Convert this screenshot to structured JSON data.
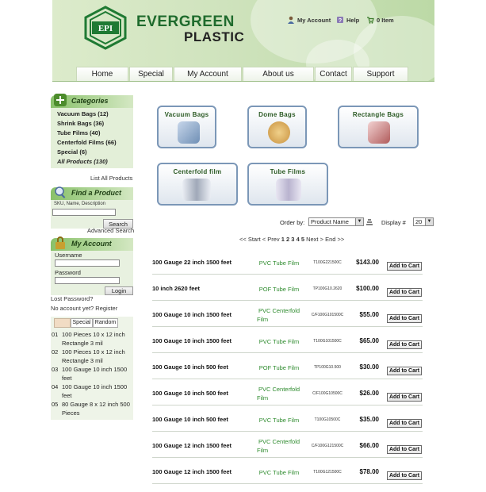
{
  "header": {
    "brand_line1": "EVERGREEN",
    "brand_line2": "PLASTIC",
    "logo_text": "EPI",
    "links": {
      "account": "My Account",
      "help": "Help",
      "cart": "0 Item"
    }
  },
  "nav": [
    {
      "label": "Home"
    },
    {
      "label": "Special"
    },
    {
      "label": "My Account"
    },
    {
      "label": "About us"
    },
    {
      "label": "Contact"
    },
    {
      "label": "Support"
    }
  ],
  "sidebar": {
    "categories_title": "Categories",
    "categories": [
      "Vacuum Bags (12)",
      "Shrink Bags (36)",
      "Tube Films (40)",
      "Centerfold Films (66)",
      "Special (6)",
      "All Products (130)"
    ],
    "list_all": "List All Products",
    "find_title": "Find a Product",
    "find_hint": "SKU, Name, Description",
    "search_button": "Search",
    "advanced_search": "Advanced Search",
    "account_title": "My Account",
    "username_label": "Username",
    "password_label": "Password",
    "login_button": "Login",
    "lost_password": "Lost Password?",
    "no_account": "No account yet? Register",
    "tabs": [
      "",
      "Special",
      "Random"
    ],
    "random_items": [
      {
        "num": "01",
        "line1": "100 Pieces 10 x 12 inch",
        "line2": "Rectangle 3 mil"
      },
      {
        "num": "02",
        "line1": "100 Pieces 10 x 12 inch",
        "line2": "Rectangle 3 mil"
      },
      {
        "num": "03",
        "line1": "100 Gauge 10 inch 1500",
        "line2": "feet"
      },
      {
        "num": "04",
        "line1": "100 Gauge 10 inch 1500",
        "line2": "feet"
      },
      {
        "num": "05",
        "line1": "80 Gauge 8 x 12 inch 500",
        "line2": "Pieces"
      }
    ]
  },
  "category_buttons": [
    {
      "label": "Vacuum Bags",
      "color": "#6f8fb5"
    },
    {
      "label": "Dome Bags",
      "color": "#c9923f"
    },
    {
      "label": "Rectangle Bags",
      "color": "#b05b5b"
    },
    {
      "label": "Centerfold film",
      "color": "#a0a8b8"
    },
    {
      "label": "Tube Films",
      "color": "#b9b3cf"
    }
  ],
  "listing": {
    "order_by_label": "Order by:",
    "order_by_value": "Product Name",
    "display_label": "Display #",
    "display_value": "20",
    "pagination": {
      "start": "<< Start",
      "prev": "< Prev",
      "pages": [
        "1",
        "2",
        "3",
        "4",
        "5"
      ],
      "next": "Next >",
      "end": "End >>"
    },
    "add_to_cart": "Add to Cart",
    "products": [
      {
        "name": "100 Gauge 22 inch 1500 feet",
        "cat1": "PVC Tube Film",
        "cat2": "",
        "sku": "T100G221500C",
        "price": "$143.00"
      },
      {
        "name": "10 inch 2620 feet",
        "cat1": "POF Tube Film",
        "cat2": "",
        "sku": "TP100G10.2620",
        "price": "$100.00"
      },
      {
        "name": "100 Gauge 10 inch 1500 feet",
        "cat1": "PVC Centerfold",
        "cat2": "Film",
        "sku": "C/F100G101500C",
        "price": "$55.00"
      },
      {
        "name": "100 Gauge 10 inch 1500 feet",
        "cat1": "PVC Tube Film",
        "cat2": "",
        "sku": "T100G101500C",
        "price": "$65.00"
      },
      {
        "name": "100 Gauge 10 inch 500 feet",
        "cat1": "POF Tube Film",
        "cat2": "",
        "sku": "TP100G10.500",
        "price": "$30.00"
      },
      {
        "name": "100 Gauge 10 inch 500 feet",
        "cat1": "PVC Centerfold",
        "cat2": "Film",
        "sku": "C/F100G10500C",
        "price": "$26.00"
      },
      {
        "name": "100 Gauge 10 inch 500 feet",
        "cat1": "PVC Tube Film",
        "cat2": "",
        "sku": "T100G10500C",
        "price": "$35.00"
      },
      {
        "name": "100 Gauge 12 inch 1500 feet",
        "cat1": "PVC Centerfold",
        "cat2": "Film",
        "sku": "C/F100G121500C",
        "price": "$66.00"
      },
      {
        "name": "100 Gauge 12 inch 1500 feet",
        "cat1": "PVC Tube Film",
        "cat2": "",
        "sku": "T100G121500C",
        "price": "$78.00"
      }
    ]
  }
}
